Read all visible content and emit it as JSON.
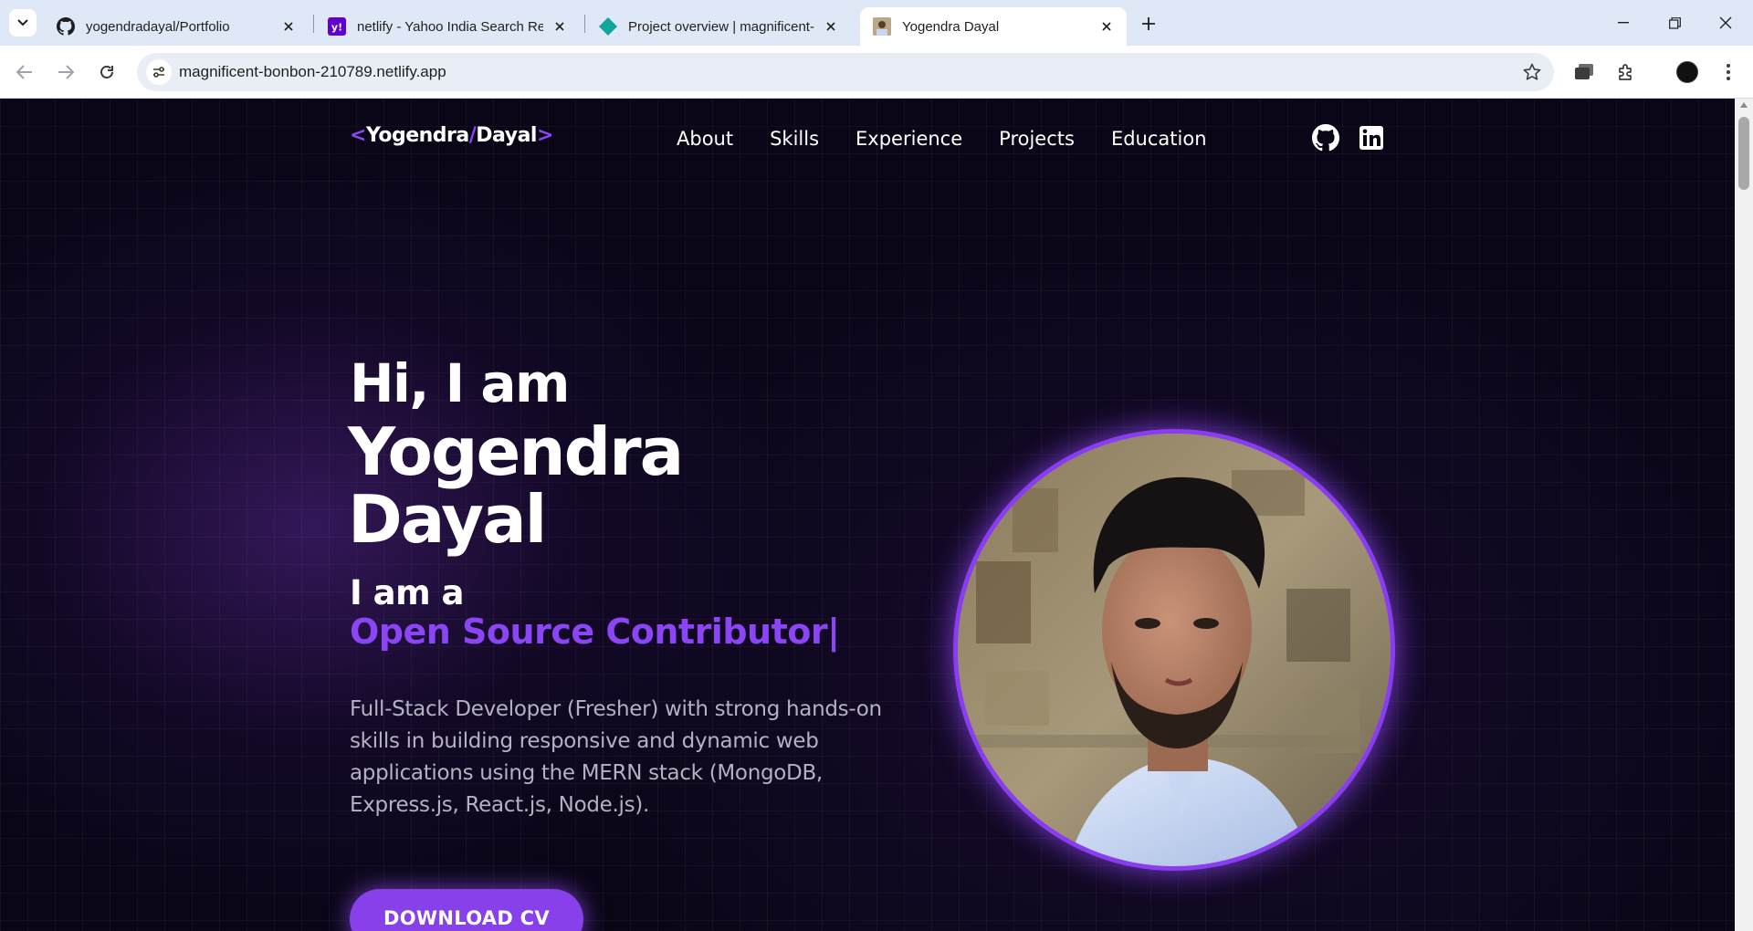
{
  "browser": {
    "tabs": [
      {
        "title": "yogendradayal/Portfolio",
        "favicon": "github-icon"
      },
      {
        "title": "netlify - Yahoo India Search Res",
        "favicon": "yahoo-icon"
      },
      {
        "title": "Project overview | magnificent-b",
        "favicon": "netlify-icon"
      },
      {
        "title": "Yogendra Dayal",
        "favicon": "profile-photo-icon",
        "active": true
      }
    ],
    "url": "magnificent-bonbon-210789.netlify.app"
  },
  "site": {
    "logo": {
      "open": "<",
      "first": "Yogendra",
      "slash": "/",
      "last": "Dayal",
      "close": ">"
    },
    "nav": [
      "About",
      "Skills",
      "Experience",
      "Projects",
      "Education"
    ],
    "social": [
      "github-icon",
      "linkedin-icon"
    ],
    "hero": {
      "greeting": "Hi, I am",
      "name_line1": "Yogendra",
      "name_line2": "Dayal",
      "iam": "I am a",
      "role": "Open Source Contributor",
      "caret": "|",
      "description": "Full-Stack Developer (Fresher) with strong hands-on skills in building responsive and dynamic web applications using the MERN stack (MongoDB, Express.js, React.js, Node.js).",
      "cta": "DOWNLOAD CV"
    }
  },
  "colors": {
    "accent": "#8b45f5",
    "background": "#0a0617",
    "chrome": "#dfe8f6"
  }
}
